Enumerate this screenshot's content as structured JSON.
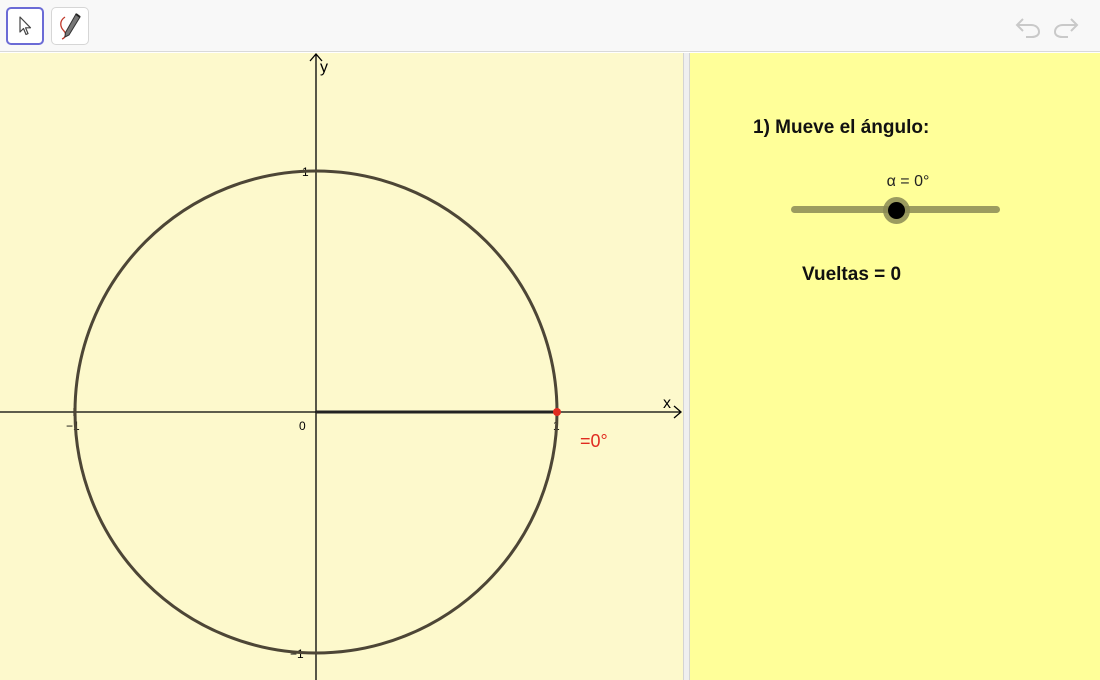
{
  "toolbar": {
    "move_tool": {
      "icon": "cursor-arrow-icon",
      "active": true
    },
    "pen_tool": {
      "icon": "pen-icon",
      "active": false
    },
    "undo": {
      "icon": "undo-icon"
    },
    "redo": {
      "icon": "redo-icon"
    }
  },
  "graphics": {
    "axis_x_label": "x",
    "axis_y_label": "y",
    "tick_x_neg1": "−1",
    "tick_x_0": "0",
    "tick_x_1": "1",
    "tick_y_1": "1",
    "tick_y_neg1": "−1",
    "angle_label": "=0°",
    "angle_color": "#e02b20",
    "circle_color": "#4d4636",
    "background": "#fdf9cc"
  },
  "panel": {
    "task_title": "1) Mueve el ángulo:",
    "slider_label": "α = 0°",
    "slider_value": 0,
    "turns_text": "Vueltas = 0",
    "background": "#ffff99"
  }
}
